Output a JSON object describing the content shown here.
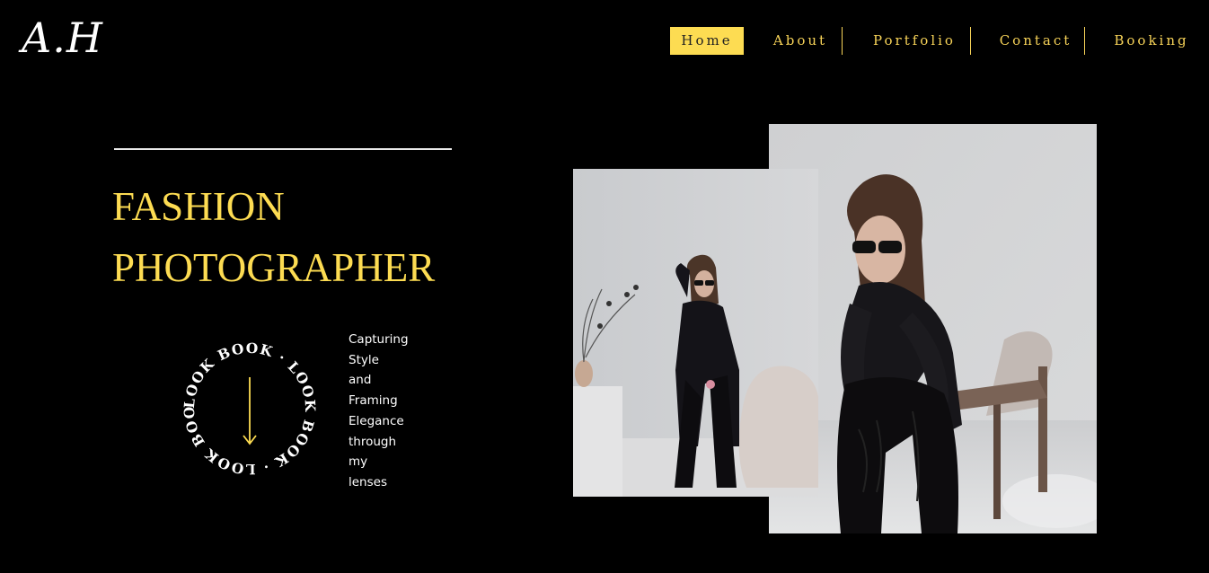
{
  "brand": {
    "logo": "A.H"
  },
  "nav": {
    "items": [
      {
        "label": "Home",
        "active": true
      },
      {
        "label": "About",
        "active": false
      },
      {
        "label": "Portfolio",
        "active": false
      },
      {
        "label": "Contact",
        "active": false
      },
      {
        "label": "Booking",
        "active": false
      }
    ]
  },
  "hero": {
    "title_line1": "FASHION",
    "title_line2": "PHOTOGRAPHER",
    "badge_text": "LOOK BOOK · LOOK BOOK · LOOK BOOK · ",
    "tagline_lines": [
      "Capturing",
      "Style",
      "and",
      "Framing",
      "Elegance",
      "through",
      "my",
      "lenses"
    ]
  },
  "images": {
    "small_alt": "Model in black outfit and sunglasses standing by wall",
    "large_alt": "Model in black outfit and sunglasses seated on chair"
  },
  "colors": {
    "background": "#000000",
    "accent": "#fddc52",
    "text": "#ffffff"
  }
}
